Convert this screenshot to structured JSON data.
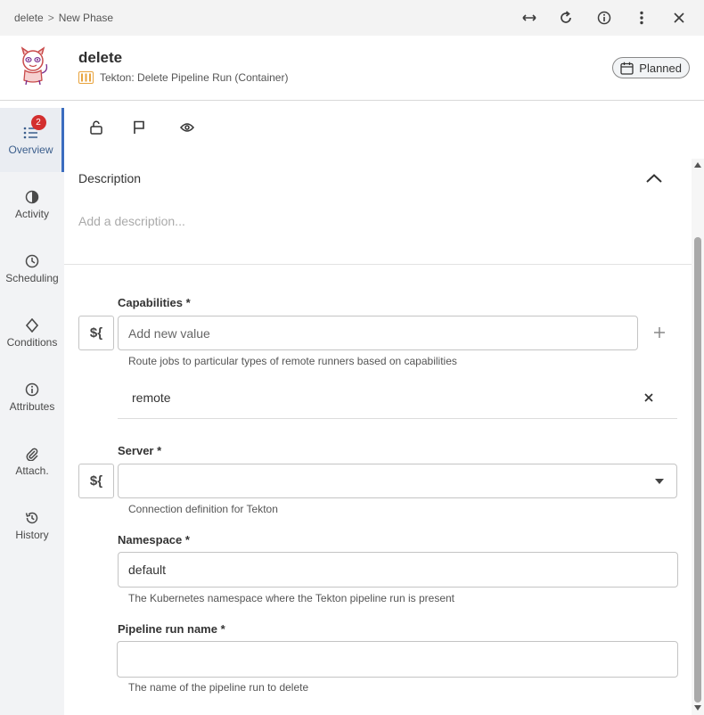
{
  "breadcrumb": {
    "first": "delete",
    "separator": ">",
    "second": "New Phase"
  },
  "window_icons": [
    "expand-horizontal-icon",
    "refresh-icon",
    "info-icon",
    "more-vertical-icon",
    "close-icon"
  ],
  "header": {
    "title": "delete",
    "subtitle": "Tekton: Delete Pipeline Run (Container)",
    "status": "Planned"
  },
  "sidebar": {
    "items": [
      {
        "label": "Overview",
        "icon": "list-icon",
        "badge": "2",
        "active": true
      },
      {
        "label": "Activity",
        "icon": "pie-icon"
      },
      {
        "label": "Scheduling",
        "icon": "clock-icon"
      },
      {
        "label": "Conditions",
        "icon": "diamond-icon"
      },
      {
        "label": "Attributes",
        "icon": "info-icon"
      },
      {
        "label": "Attach.",
        "icon": "paperclip-icon"
      },
      {
        "label": "History",
        "icon": "history-icon"
      }
    ]
  },
  "toolbar_icons": [
    "unlock-icon",
    "flag-icon",
    "eye-icon"
  ],
  "description": {
    "heading": "Description",
    "placeholder": "Add a description..."
  },
  "form": {
    "var_button": "${",
    "capabilities": {
      "label": "Capabilities *",
      "placeholder": "Add new value",
      "help": "Route jobs to particular types of remote runners based on capabilities",
      "values": [
        "remote"
      ]
    },
    "server": {
      "label": "Server *",
      "value": "",
      "help": "Connection definition for Tekton"
    },
    "namespace": {
      "label": "Namespace *",
      "value": "default",
      "help": "The Kubernetes namespace where the Tekton pipeline run is present"
    },
    "pipeline_run_name": {
      "label": "Pipeline run name *",
      "value": "",
      "help": "The name of the pipeline run to delete"
    }
  },
  "colors": {
    "accent": "#3b6dbf",
    "badge": "#d32f2f",
    "plugin_icon": "#e8a33d",
    "sidebar_bg": "#f2f3f5",
    "topbar_bg": "#f3f3f3"
  }
}
